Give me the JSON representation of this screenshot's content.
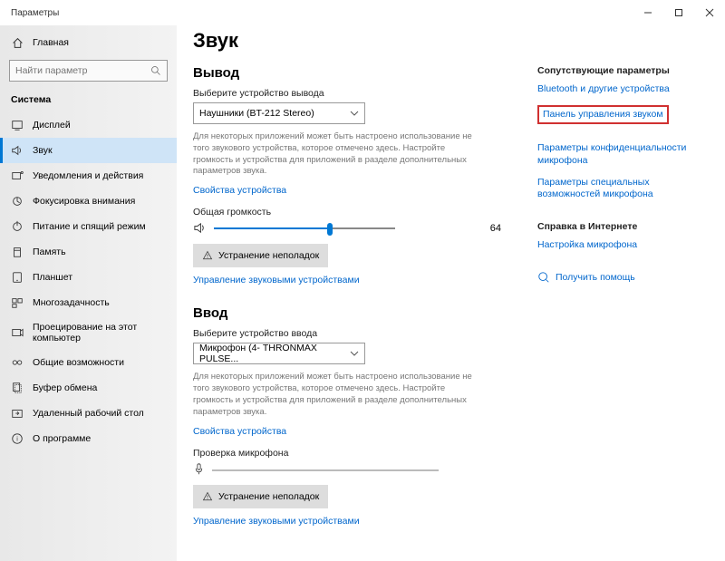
{
  "window": {
    "title": "Параметры"
  },
  "sidebar": {
    "home": "Главная",
    "search_placeholder": "Найти параметр",
    "category": "Система",
    "items": [
      {
        "label": "Дисплей",
        "active": false
      },
      {
        "label": "Звук",
        "active": true
      },
      {
        "label": "Уведомления и действия",
        "active": false
      },
      {
        "label": "Фокусировка внимания",
        "active": false
      },
      {
        "label": "Питание и спящий режим",
        "active": false
      },
      {
        "label": "Память",
        "active": false
      },
      {
        "label": "Планшет",
        "active": false
      },
      {
        "label": "Многозадачность",
        "active": false
      },
      {
        "label": "Проецирование на этот компьютер",
        "active": false
      },
      {
        "label": "Общие возможности",
        "active": false
      },
      {
        "label": "Буфер обмена",
        "active": false
      },
      {
        "label": "Удаленный рабочий стол",
        "active": false
      },
      {
        "label": "О программе",
        "active": false
      }
    ]
  },
  "page": {
    "title": "Звук",
    "output": {
      "heading": "Вывод",
      "choose_label": "Выберите устройство вывода",
      "device": "Наушники (BT-212 Stereo)",
      "desc": "Для некоторых приложений может быть настроено использование не того звукового устройства, которое отмечено здесь. Настройте громкость и устройства для приложений в разделе дополнительных параметров звука.",
      "properties": "Свойства устройства",
      "volume_label": "Общая громкость",
      "volume_value": 64,
      "troubleshoot": "Устранение неполадок",
      "manage": "Управление звуковыми устройствами"
    },
    "input": {
      "heading": "Ввод",
      "choose_label": "Выберите устройство ввода",
      "device": "Микрофон (4- THRONMAX PULSE...",
      "desc": "Для некоторых приложений может быть настроено использование не того звукового устройства, которое отмечено здесь. Настройте громкость и устройства для приложений в разделе дополнительных параметров звука.",
      "properties": "Свойства устройства",
      "test_label": "Проверка микрофона",
      "troubleshoot": "Устранение неполадок",
      "manage": "Управление звуковыми устройствами"
    }
  },
  "related": {
    "heading": "Сопутствующие параметры",
    "links": [
      "Bluetooth и другие устройства",
      "Панель управления звуком",
      "Параметры конфиденциальности микрофона",
      "Параметры специальных возможностей микрофона"
    ],
    "help_heading": "Справка в Интернете",
    "help_link": "Настройка микрофона",
    "get_help": "Получить помощь"
  }
}
